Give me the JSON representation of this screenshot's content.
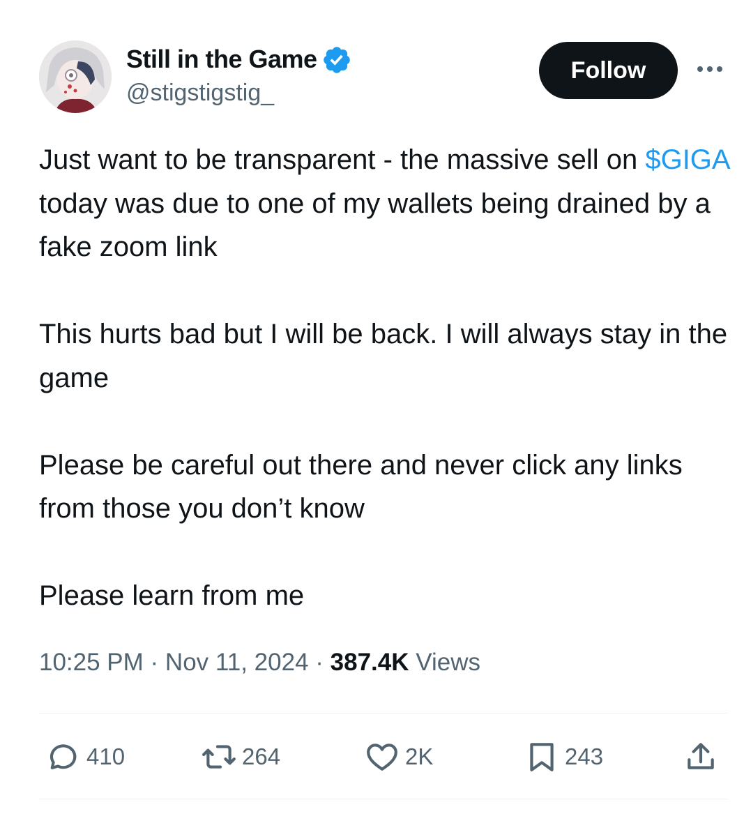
{
  "author": {
    "display_name": "Still in the Game",
    "handle": "@stigstigstig_",
    "verified": true
  },
  "follow_button": {
    "label": "Follow"
  },
  "tweet": {
    "paragraphs": [
      {
        "cashtag": "",
        "before": "Just want to be transparent - the massive sell on ",
        "after": ""
      },
      {
        "cashtag": "$GIGA",
        "before": "",
        "after": " today was due to one of my wallets being drained by a fake zoom link"
      },
      {
        "cashtag": "",
        "before": "This hurts bad but I will be back. I will always stay in the game",
        "after": ""
      },
      {
        "cashtag": "",
        "before": "Please be careful out there and never click any links from those you don’t know",
        "after": ""
      },
      {
        "cashtag": "",
        "before": "Please learn from me",
        "after": ""
      }
    ]
  },
  "meta": {
    "time": "10:25 PM",
    "separator": " · ",
    "date": "Nov 11, 2024",
    "views_count": "387.4K",
    "views_label": " Views"
  },
  "actions": {
    "replies": "410",
    "reposts": "264",
    "likes": "2K",
    "bookmarks": "243"
  },
  "colors": {
    "accent": "#1d9bf0",
    "text": "#0f1419",
    "muted": "#536471",
    "divider": "#eff3f4"
  },
  "icons": [
    "verified-badge-icon",
    "more-icon",
    "reply-icon",
    "repost-icon",
    "like-icon",
    "bookmark-icon",
    "share-icon"
  ]
}
